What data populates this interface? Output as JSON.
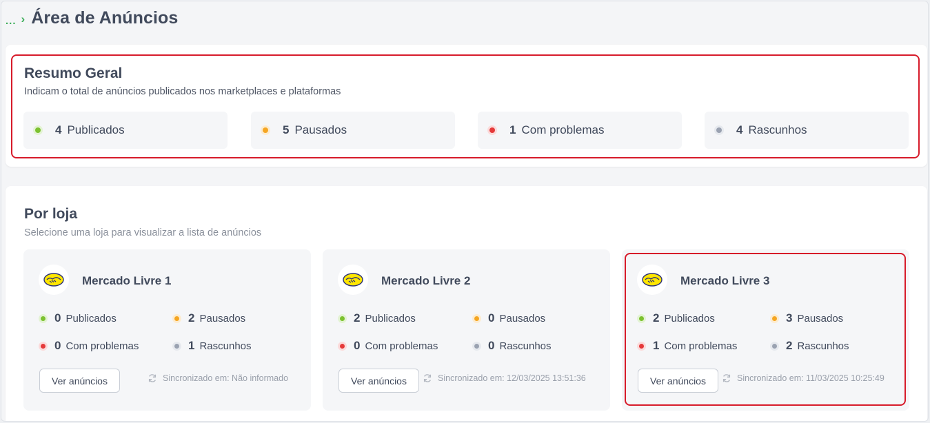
{
  "breadcrumb": {
    "ellipsis": "...",
    "separator": "›",
    "title": "Área de Anúncios"
  },
  "summary": {
    "title": "Resumo Geral",
    "subtitle": "Indicam o total de anúncios publicados nos marketplaces e plataformas",
    "stats": [
      {
        "count": "4",
        "label": "Publicados",
        "color": "#7cc130"
      },
      {
        "count": "5",
        "label": "Pausados",
        "color": "#f5a623"
      },
      {
        "count": "1",
        "label": "Com problemas",
        "color": "#e5393a"
      },
      {
        "count": "4",
        "label": "Rascunhos",
        "color": "#9aa2b1"
      }
    ]
  },
  "stores_section": {
    "title": "Por loja",
    "subtitle": "Selecione uma loja para visualizar a lista de anúncios",
    "button_label": "Ver anúncios",
    "stores": [
      {
        "name": "Mercado Livre 1",
        "publicados": "0",
        "pausados": "2",
        "com_problemas": "0",
        "rascunhos": "1",
        "sync": "Sincronizado em: Não informado"
      },
      {
        "name": "Mercado Livre 2",
        "publicados": "2",
        "pausados": "0",
        "com_problemas": "0",
        "rascunhos": "0",
        "sync": "Sincronizado em: 12/03/2025 13:51:36"
      },
      {
        "name": "Mercado Livre 3",
        "publicados": "2",
        "pausados": "3",
        "com_problemas": "1",
        "rascunhos": "2",
        "sync": "Sincronizado em: 11/03/2025 10:25:49"
      }
    ],
    "labels": {
      "publicados": "Publicados",
      "pausados": "Pausados",
      "com_problemas": "Com problemas",
      "rascunhos": "Rascunhos"
    }
  },
  "colors": {
    "highlight": "#d71b2a",
    "accent": "#3dae5a"
  }
}
